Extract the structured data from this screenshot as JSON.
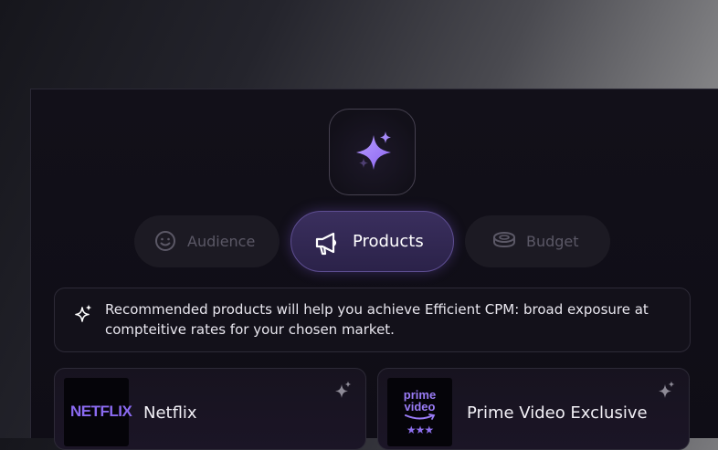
{
  "tabs": [
    {
      "label": "Audience",
      "icon": "smiley-icon",
      "state": "inactive"
    },
    {
      "label": "Products",
      "icon": "megaphone-icon",
      "state": "active"
    },
    {
      "label": "Budget",
      "icon": "coin-stack-icon",
      "state": "inactive"
    }
  ],
  "hero": {
    "icon": "sparkle-icon"
  },
  "recommendation": {
    "icon": "sparkle-icon",
    "text": "Recommended products will help you achieve Efficient CPM: broad exposure at compteitive rates for your chosen market."
  },
  "products": [
    {
      "name": "Netflix",
      "logo_text": "NETFLIX",
      "icon": "sparkle-icon"
    },
    {
      "name": "Prime Video Exclusive",
      "logo_line1": "prime",
      "logo_line2": "video",
      "logo_stars": "★★★",
      "icon": "sparkle-icon"
    }
  ],
  "colors": {
    "accent": "#8b6cf3",
    "panel_bg": "#121019",
    "active_tab_bg": "#33295a",
    "inactive_text": "#5b5866"
  }
}
